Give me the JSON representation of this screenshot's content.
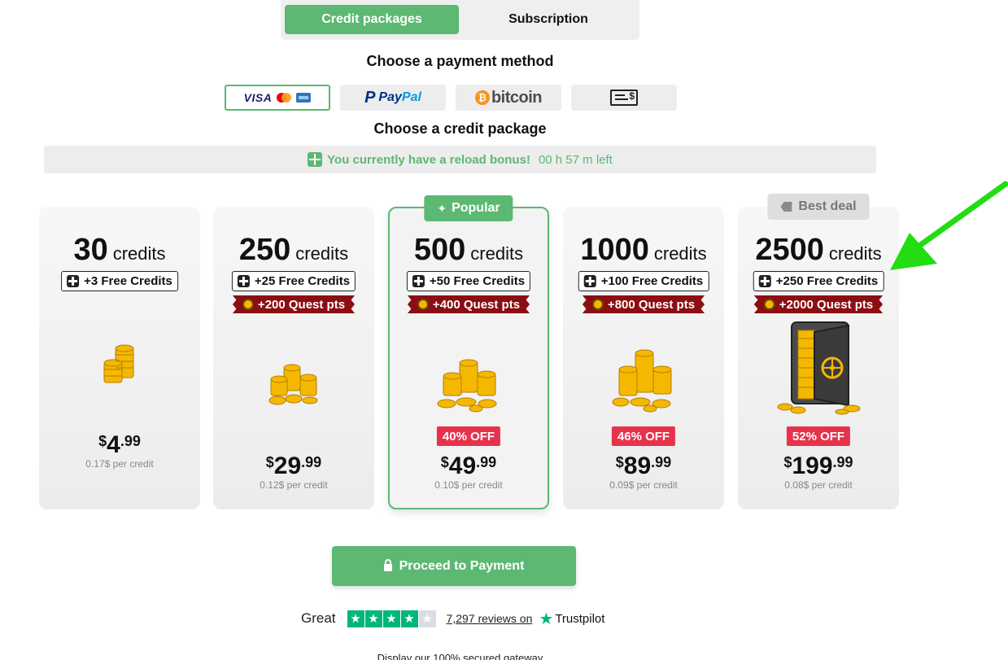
{
  "tabs": [
    {
      "label": "Credit packages",
      "active": true
    },
    {
      "label": "Subscription",
      "active": false
    }
  ],
  "payment": {
    "heading": "Choose a payment method",
    "methods": [
      {
        "name": "card",
        "labels": {
          "visa": "VISA"
        },
        "selected": true
      },
      {
        "name": "paypal",
        "labels": {
          "pay": "Pay",
          "pal": "Pal",
          "mark": "P"
        }
      },
      {
        "name": "bitcoin",
        "labels": {
          "symbol": "₿",
          "word": "bitcoin"
        }
      },
      {
        "name": "check",
        "labels": {
          "symbol": "$"
        }
      }
    ]
  },
  "package_heading": "Choose a credit package",
  "bonus": {
    "message": "You currently have a reload bonus!",
    "time_left": "00 h 57 m left"
  },
  "packages": [
    {
      "credits": "30",
      "unit": "credits",
      "free": "+3 Free Credits",
      "quest": null,
      "discount": null,
      "currency": "$",
      "price_int": "4",
      "price_dec": ".99",
      "per_credit": "0.17$ per credit",
      "badge": null
    },
    {
      "credits": "250",
      "unit": "credits",
      "free": "+25 Free Credits",
      "quest": "+200 Quest pts",
      "discount": null,
      "currency": "$",
      "price_int": "29",
      "price_dec": ".99",
      "per_credit": "0.12$ per credit",
      "badge": null
    },
    {
      "credits": "500",
      "unit": "credits",
      "free": "+50 Free Credits",
      "quest": "+400 Quest pts",
      "discount": "40% OFF",
      "currency": "$",
      "price_int": "49",
      "price_dec": ".99",
      "per_credit": "0.10$ per credit",
      "badge": "Popular"
    },
    {
      "credits": "1000",
      "unit": "credits",
      "free": "+100 Free Credits",
      "quest": "+800 Quest pts",
      "discount": "46% OFF",
      "currency": "$",
      "price_int": "89",
      "price_dec": ".99",
      "per_credit": "0.09$ per credit",
      "badge": null
    },
    {
      "credits": "2500",
      "unit": "credits",
      "free": "+250 Free Credits",
      "quest": "+2000 Quest pts",
      "discount": "52% OFF",
      "currency": "$",
      "price_int": "199",
      "price_dec": ".99",
      "per_credit": "0.08$ per credit",
      "badge": "Best deal"
    }
  ],
  "proceed_label": "Proceed to Payment",
  "trustpilot": {
    "rating_word": "Great",
    "stars": 4.5,
    "reviews": "7,297 reviews on",
    "brand": "Trustpilot"
  },
  "secured_text": "Display our 100% secured gateway",
  "colors": {
    "accent_green": "#5cb872",
    "discount_red": "#e6334b",
    "quest_red": "#8b0e12",
    "trustpilot_green": "#00b67a",
    "arrow_green": "#22dd11"
  }
}
